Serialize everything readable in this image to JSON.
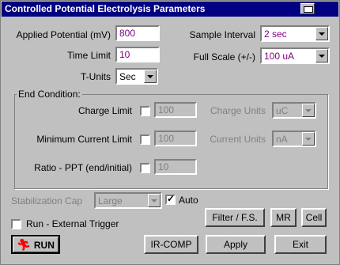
{
  "window": {
    "title": "Controlled Potential Electrolysis Parameters",
    "print_icon": "printer-icon"
  },
  "applied_potential": {
    "label": "Applied Potential (mV)",
    "value": "800"
  },
  "time_limit": {
    "label": "Time Limit",
    "value": "10"
  },
  "t_units": {
    "label": "T-Units",
    "value": "Sec"
  },
  "sample_interval": {
    "label": "Sample Interval",
    "value": "2 sec"
  },
  "full_scale": {
    "label": "Full Scale (+/-)",
    "value": "100 uA"
  },
  "end_condition": {
    "title": "End Condition:",
    "charge_limit": {
      "label": "Charge Limit",
      "value": "100",
      "units_label": "Charge Units",
      "units_value": "uC"
    },
    "min_current": {
      "label": "Minimum Current Limit",
      "value": "100",
      "units_label": "Current Units",
      "units_value": "nA"
    },
    "ratio": {
      "label": "Ratio - PPT (end/initial)",
      "value": "10"
    }
  },
  "stabilization": {
    "label": "Stabilization Cap",
    "value": "Large",
    "auto_label": "Auto",
    "auto_checked": true
  },
  "run_external": {
    "label": "Run - External Trigger",
    "checked": false
  },
  "buttons": {
    "filter": "Filter / F.S.",
    "mr": "MR",
    "cell": "Cell",
    "run": "RUN",
    "ircomp": "IR-COMP",
    "apply": "Apply",
    "exit": "Exit"
  },
  "colors": {
    "title_bar": "#000080",
    "value_text": "#800080",
    "run_icon": "#ff0000"
  }
}
